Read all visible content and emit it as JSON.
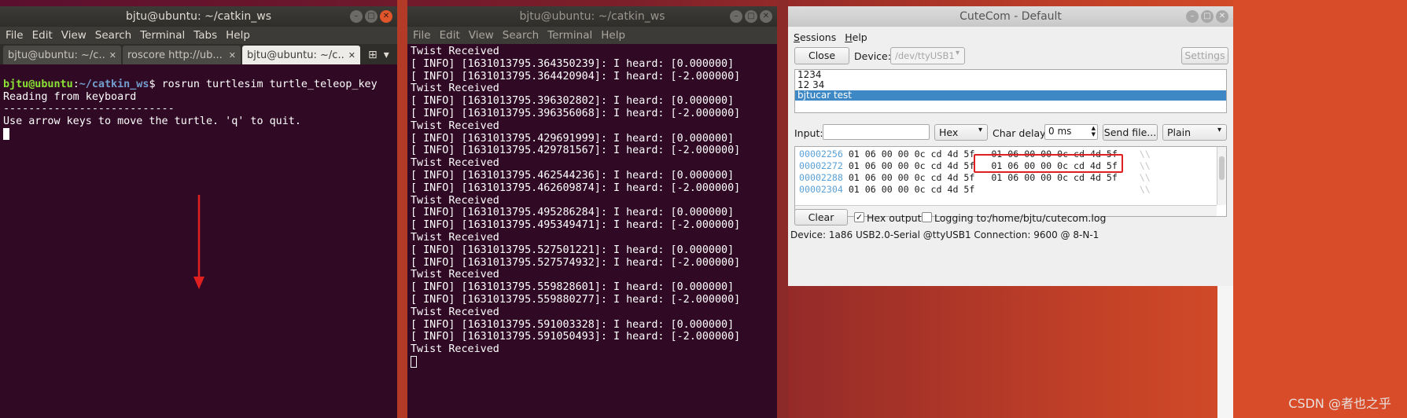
{
  "term1": {
    "title": "bjtu@ubuntu: ~/catkin_ws",
    "menu": [
      "File",
      "Edit",
      "View",
      "Search",
      "Terminal",
      "Tabs",
      "Help"
    ],
    "tabs": [
      "bjtu@ubuntu: ~/c...",
      "roscore http://ub...",
      "bjtu@ubuntu: ~/c..."
    ],
    "prompt_user": "bjtu@ubuntu",
    "prompt_path": "~/catkin_ws",
    "prompt_sep": ":",
    "prompt_end": "$ ",
    "command": "rosrun turtlesim turtle_teleop_key",
    "lines": [
      "Reading from keyboard",
      "---------------------------",
      "Use arrow keys to move the turtle. 'q' to quit."
    ]
  },
  "term2": {
    "title": "bjtu@ubuntu: ~/catkin_ws",
    "menu": [
      "File",
      "Edit",
      "View",
      "Search",
      "Terminal",
      "Help"
    ],
    "lines": [
      "Twist Received",
      "[ INFO] [1631013795.364350239]: I heard: [0.000000]",
      "[ INFO] [1631013795.364420904]: I heard: [-2.000000]",
      "Twist Received",
      "[ INFO] [1631013795.396302802]: I heard: [0.000000]",
      "[ INFO] [1631013795.396356068]: I heard: [-2.000000]",
      "Twist Received",
      "[ INFO] [1631013795.429691999]: I heard: [0.000000]",
      "[ INFO] [1631013795.429781567]: I heard: [-2.000000]",
      "Twist Received",
      "[ INFO] [1631013795.462544236]: I heard: [0.000000]",
      "[ INFO] [1631013795.462609874]: I heard: [-2.000000]",
      "Twist Received",
      "[ INFO] [1631013795.495286284]: I heard: [0.000000]",
      "[ INFO] [1631013795.495349471]: I heard: [-2.000000]",
      "Twist Received",
      "[ INFO] [1631013795.527501221]: I heard: [0.000000]",
      "[ INFO] [1631013795.527574932]: I heard: [-2.000000]",
      "Twist Received",
      "[ INFO] [1631013795.559828601]: I heard: [0.000000]",
      "[ INFO] [1631013795.559880277]: I heard: [-2.000000]",
      "Twist Received",
      "[ INFO] [1631013795.591003328]: I heard: [0.000000]",
      "[ INFO] [1631013795.591050493]: I heard: [-2.000000]",
      "Twist Received"
    ]
  },
  "cutecom": {
    "title": "CuteCom - Default",
    "menu": [
      "Sessions",
      "Help"
    ],
    "close_label": "Close",
    "device_label": "Device:",
    "device_value": "/dev/ttyUSB1",
    "settings_label": "Settings",
    "history": [
      "1234",
      "12 34",
      "bjtucar test"
    ],
    "input_label": "Input:",
    "input_value": "",
    "input_mode": "Hex",
    "char_delay_label": "Char delay:",
    "char_delay_value": "0 ms",
    "send_file_label": "Send file...",
    "line_end": "Plain",
    "hex_rows": [
      {
        "addr": "00002256",
        "a": "01 06 00 00 0c cd 4d 5f",
        "b": "01 06 00 00 0c cd 4d 5f",
        "asc": "\\\\"
      },
      {
        "addr": "00002272",
        "a": "01 06 00 00 0c cd 4d 5f",
        "b": "01 06 00 00 0c cd 4d 5f",
        "asc": "\\\\"
      },
      {
        "addr": "00002288",
        "a": "01 06 00 00 0c cd 4d 5f",
        "b": "01 06 00 00 0c cd 4d 5f",
        "asc": "\\\\"
      },
      {
        "addr": "00002304",
        "a": "01 06 00 00 0c cd 4d 5f",
        "b": "",
        "asc": "\\\\"
      }
    ],
    "clear_label": "Clear",
    "hex_output_label": "Hex output",
    "hex_output_checked": true,
    "logging_label": "Logging to:",
    "logging_checked": false,
    "log_path": "/home/bjtu/cutecom.log",
    "status_device_label": "Device:",
    "status_device": "1a86 USB2.0-Serial @ttyUSB1",
    "status_connection_label": "Connection:",
    "status_connection": "9600 @ 8-N-1"
  },
  "watermark": "CSDN @者也之乎",
  "colors": {
    "terminal_bg": "#300a24",
    "prompt_user": "#8ae234",
    "prompt_path": "#729fcf",
    "annotation": "#e02020",
    "selection": "#3d88c5"
  }
}
